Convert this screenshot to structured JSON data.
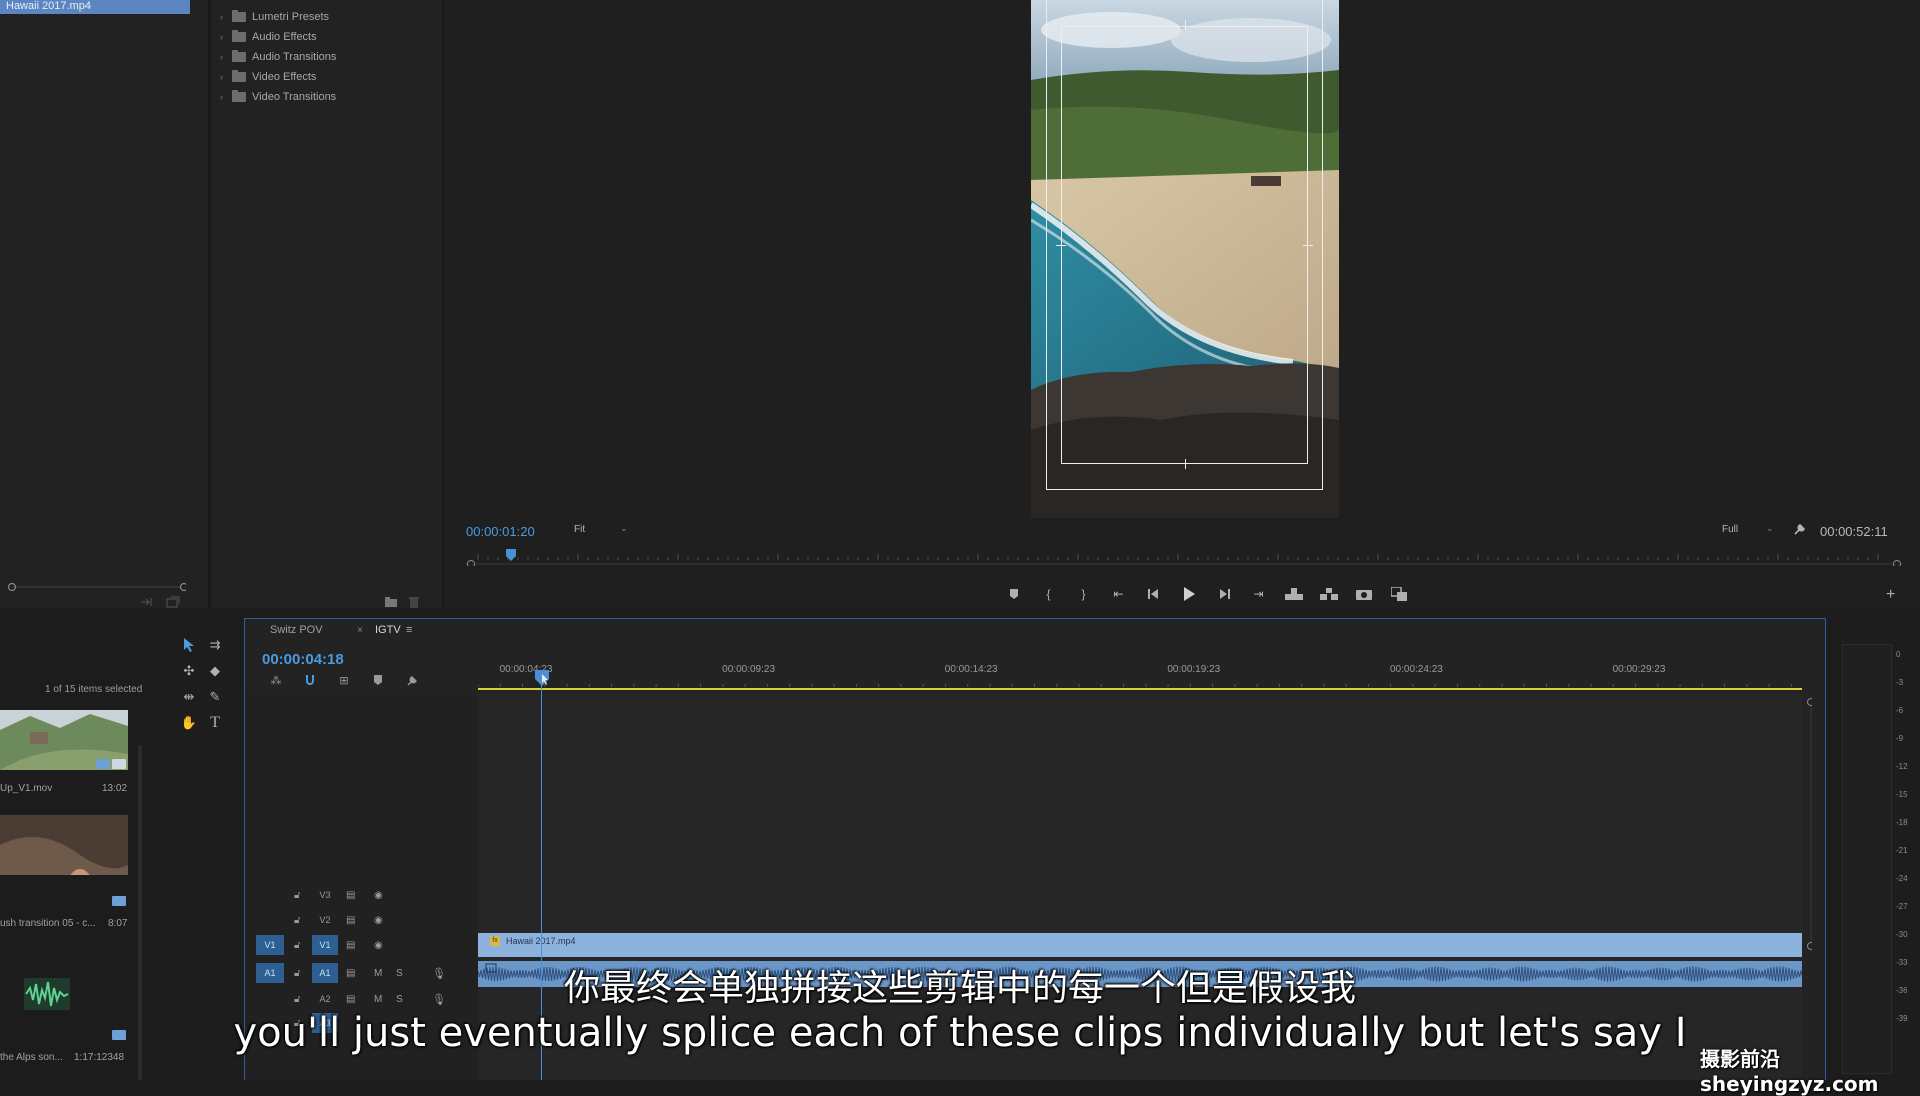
{
  "project": {
    "selected_item": "Hawaii 2017.mp4"
  },
  "effects": {
    "items": [
      "Lumetri Presets",
      "Audio Effects",
      "Audio Transitions",
      "Video Effects",
      "Video Transitions"
    ]
  },
  "program_monitor": {
    "timecode_current": "00:00:01:20",
    "fit_label": "Fit",
    "resolution_label": "Full",
    "timecode_duration": "00:00:52:11",
    "playhead_fraction": 0.03
  },
  "bin": {
    "selection_count": "1 of 15 items selected",
    "items": [
      {
        "name": "Up_V1.mov",
        "duration": "13:02"
      },
      {
        "name": "ush transition 05 - c...",
        "duration": "8:07"
      },
      {
        "name": "the Alps son...",
        "duration": "1:17:12348"
      }
    ]
  },
  "timeline": {
    "tabs": [
      {
        "label": "Switz POV"
      },
      {
        "label": "IGTV"
      }
    ],
    "tab_close": "×",
    "tab_menu": "≡",
    "timecode": "00:00:04:18",
    "ruler_labels": [
      "00:00:04:23",
      "00:00:09:23",
      "00:00:14:23",
      "00:00:19:23",
      "00:00:24:23",
      "00:00:29:23"
    ],
    "tracks": [
      {
        "name": "V3"
      },
      {
        "name": "V2"
      },
      {
        "source": "V1",
        "name": "V1"
      },
      {
        "source": "A1",
        "name": "A1",
        "m": "M",
        "s": "S"
      },
      {
        "name": "A2",
        "m": "M",
        "s": "S"
      },
      {
        "name": "A3"
      }
    ],
    "clip_v1_name": "Hawaii 2017.mp4"
  },
  "meter": {
    "db_labels": [
      "0",
      "-3",
      "-6",
      "-9",
      "-12",
      "-15",
      "-18",
      "-21",
      "-24",
      "-27",
      "-30",
      "-33",
      "-36",
      "-39"
    ]
  },
  "subtitles": {
    "chinese": "你最终会单独拼接这些剪辑中的每一个但是假设我",
    "english": "you'll just eventually splice each of these clips individually but let's say I"
  },
  "watermark": "摄影前沿 sheyingzyz.com",
  "colors": {
    "accent_timecode": "#4a9be0",
    "selection": "#5b86c1",
    "clip_video": "#8db2de",
    "clip_audio": "#6a96c8",
    "work_area": "#d8cf3a"
  }
}
